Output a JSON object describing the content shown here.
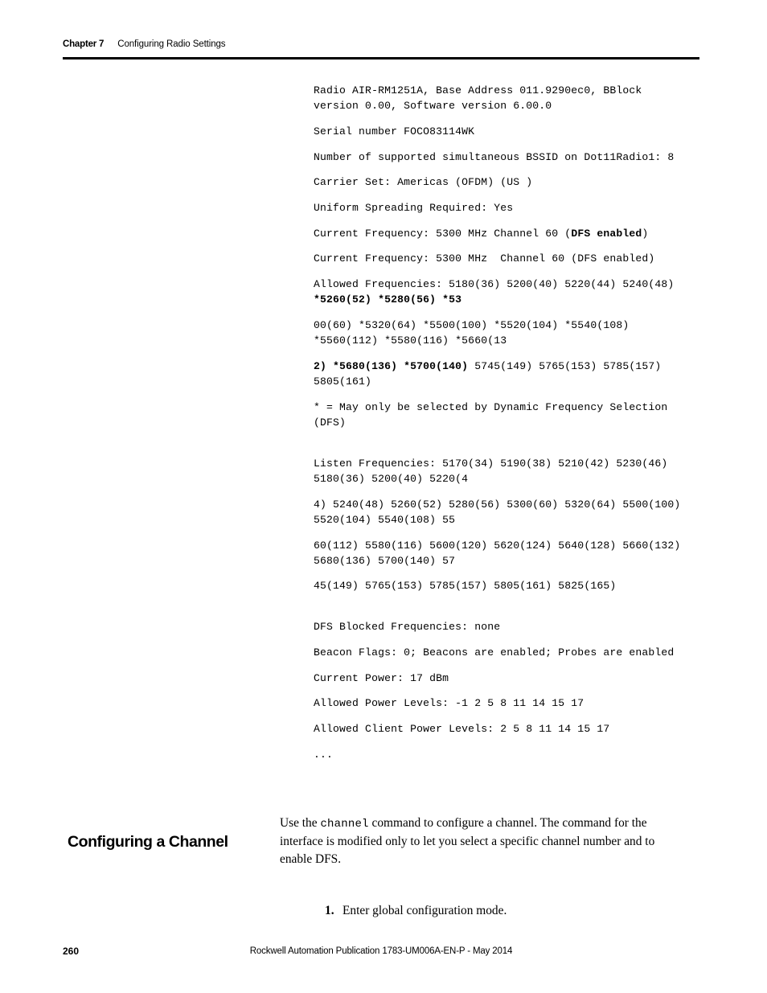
{
  "header": {
    "chapter_label": "Chapter 7",
    "chapter_title": "Configuring Radio Settings"
  },
  "code_output": {
    "line_1a": "Radio AIR-RM1251A, Base Address 011.9290ec0, BBlock ",
    "line_1b": "version 0.00, Software version 6.00.0",
    "line_2": "Serial number FOCO83114WK",
    "line_3": "Number of supported simultaneous BSSID on Dot11Radio1: 8",
    "line_4": "Carrier Set: Americas (OFDM) (US )",
    "line_5": "Uniform Spreading Required: Yes",
    "line_6_pre": "Current Frequency: 5300 MHz Channel 60 (",
    "line_6_bold": "DFS enabled",
    "line_6_post": ")",
    "line_7": "Current Frequency: 5300 MHz  Channel 60 (DFS enabled)",
    "line_8_pre": "Allowed Frequencies: 5180(36) 5200(40) 5220(44) 5240(48) ",
    "line_8_bold": "*5260(52) *5280(56) *53",
    "line_9": "00(60) *5320(64) *5500(100) *5520(104) *5540(108) *5560(112) *5580(116) *5660(13",
    "line_10_bold": "2) *5680(136) *5700(140)",
    "line_10_post": " 5745(149) 5765(153) 5785(157) 5805(161)",
    "line_11": "* = May only be selected by Dynamic Frequency Selection (DFS)",
    "line_12": "Listen Frequencies: 5170(34) 5190(38) 5210(42) 5230(46) 5180(36) 5200(40) 5220(4",
    "line_13": "4) 5240(48) 5260(52) 5280(56) 5300(60) 5320(64) 5500(100) 5520(104) 5540(108) 55",
    "line_14": "60(112) 5580(116) 5600(120) 5620(124) 5640(128) 5660(132) 5680(136) 5700(140) 57",
    "line_15": "45(149) 5765(153) 5785(157) 5805(161) 5825(165)",
    "line_16": "DFS Blocked Frequencies: none",
    "line_17": "Beacon Flags: 0; Beacons are enabled; Probes are enabled",
    "line_18": "Current Power: 17 dBm",
    "line_19": "Allowed Power Levels: -1 2 5 8 11 14 15 17",
    "line_20": "Allowed Client Power Levels: 2 5 8 11 14 15 17",
    "line_21": "..."
  },
  "section": {
    "heading": "Configuring a Channel",
    "paragraph_part_1": "Use the ",
    "paragraph_code": "channel",
    "paragraph_part_2": " command to configure a channel. The command for the interface is modified only to let you select a specific channel number and to enable DFS.",
    "steps": [
      {
        "number": "1.",
        "text": "Enter global configuration mode."
      }
    ]
  },
  "footer": {
    "page_number": "260",
    "publication": "Rockwell Automation Publication 1783-UM006A-EN-P - May 2014"
  }
}
